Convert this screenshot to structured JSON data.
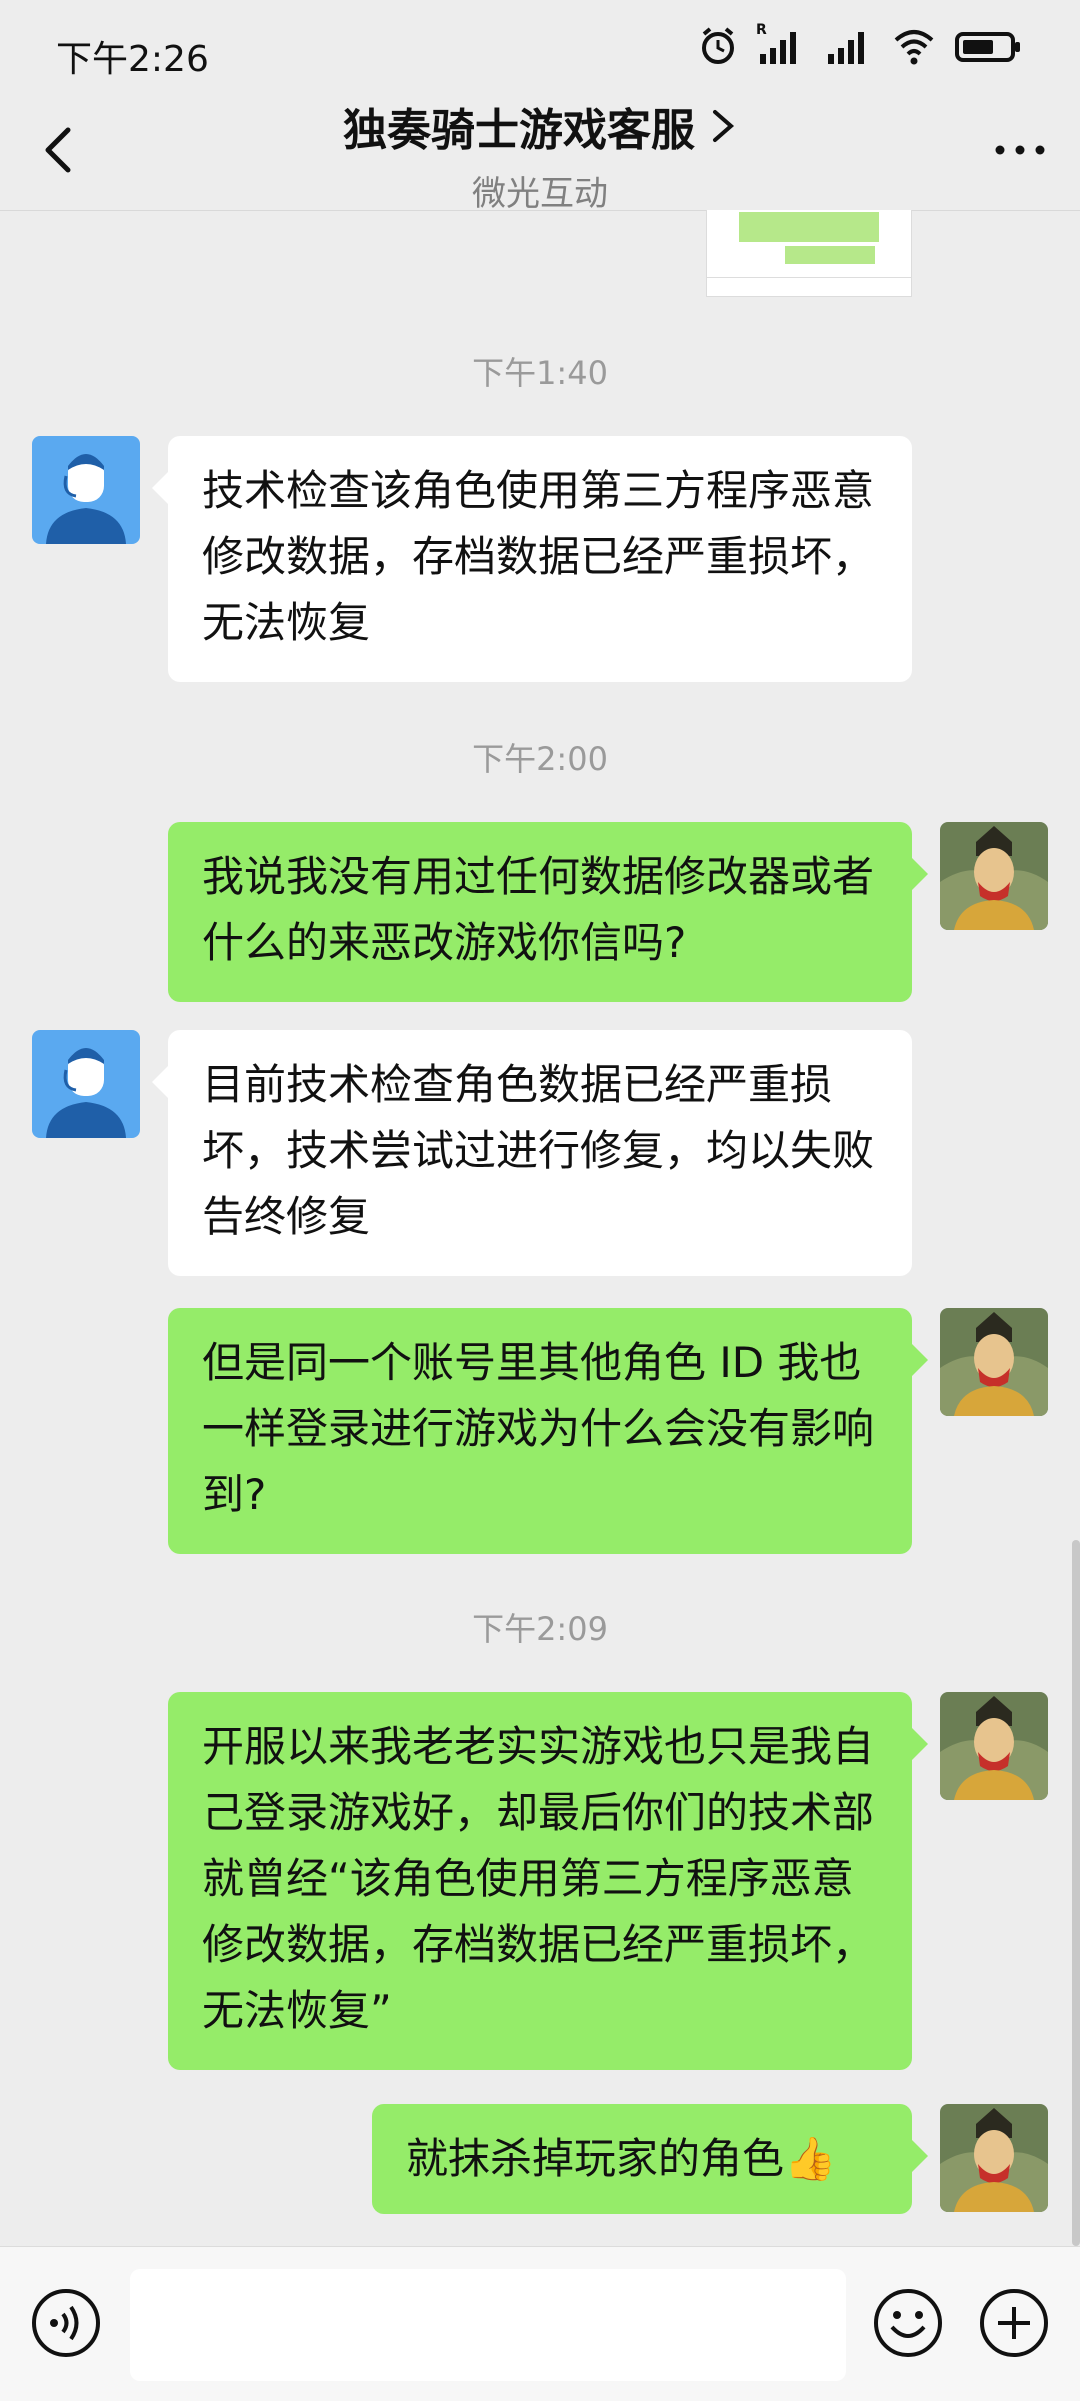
{
  "status": {
    "time": "下午2:26",
    "signal_label": "R"
  },
  "header": {
    "title": "独奏骑士游戏客服",
    "subtitle": "微光互动"
  },
  "messages": [
    {
      "type": "time",
      "text": "下午1:40"
    },
    {
      "type": "in",
      "text": "技术检查该角色使用第三方程序恶意修改数据，存档数据已经严重损坏，无法恢复"
    },
    {
      "type": "time",
      "text": "下午2:00"
    },
    {
      "type": "out",
      "text": "我说我没有用过任何数据修改器或者什么的来恶改游戏你信吗?"
    },
    {
      "type": "in",
      "text": "目前技术检查角色数据已经严重损坏，技术尝试过进行修复，均以失败告终修复"
    },
    {
      "type": "out",
      "text": "但是同一个账号里其他角色 ID 我也一样登录进行游戏为什么会没有影响到?"
    },
    {
      "type": "time",
      "text": "下午2:09"
    },
    {
      "type": "out",
      "text": "开服以来我老老实实游戏也只是我自己登录游戏好，却最后你们的技术部就曾经“该角色使用第三方程序恶意修改数据，存档数据已经严重损坏，无法恢复”"
    },
    {
      "type": "out",
      "text": "就抹杀掉玩家的角色👍"
    }
  ],
  "input": {
    "value": ""
  },
  "colors": {
    "outgoing_bubble": "#95ec69",
    "incoming_bubble": "#ffffff",
    "background": "#ededed",
    "agent_avatar": "#5aa9f0"
  },
  "icons": [
    "back-arrow-icon",
    "chevron-right-icon",
    "more-dots-icon",
    "alarm-icon",
    "signal-icon",
    "wifi-icon",
    "battery-icon",
    "voice-icon",
    "emoji-icon",
    "plus-icon"
  ]
}
